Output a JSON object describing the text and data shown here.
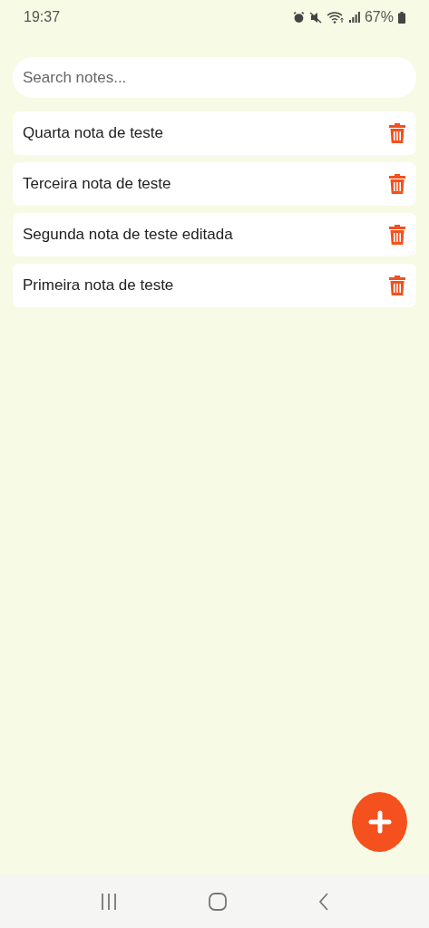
{
  "status_bar": {
    "time": "19:37",
    "battery": "67%"
  },
  "search": {
    "placeholder": "Search notes..."
  },
  "notes": [
    {
      "title": "Quarta nota de teste"
    },
    {
      "title": "Terceira nota de teste"
    },
    {
      "title": "Segunda nota de teste editada"
    },
    {
      "title": "Primeira nota de teste"
    }
  ]
}
